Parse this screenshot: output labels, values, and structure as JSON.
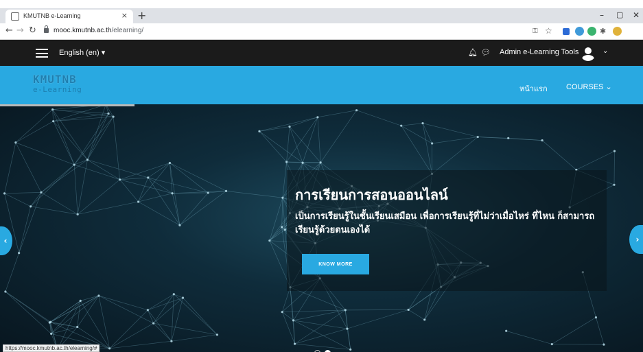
{
  "browser": {
    "tab_title": "KMUTNB e-Learning",
    "tab_close": "×",
    "new_tab": "+",
    "url_host": "mooc.kmutnb.ac.th",
    "url_path": "/elearning/",
    "window_controls": [
      "–",
      "▢",
      "✕"
    ],
    "status_url": "https://mooc.kmutnb.ac.th/elearning/#"
  },
  "site": {
    "language": "English (en)",
    "username": "Admin e-Learning Tools",
    "logo_line1": "KMUTNB",
    "logo_line2": "e-Learning",
    "nav": {
      "home": "หน้าแรก",
      "courses": "COURSES"
    }
  },
  "hero": {
    "title": "การเรียนการสอนออนไลน์",
    "text": "เป็นการเรียนรู้ในชั้นเรียนเสมือน เพื่อการเรียนรู้ที่ไม่ว่าเมื่อไหร่ ที่ไหน ก็สามารถเรียนรู้ด้วยตนเองได้",
    "cta_label": "KNOW MORE",
    "slides": 2,
    "active_slide": 2
  },
  "icons": {
    "menu": "hamburger-icon",
    "notifications": "bell-icon",
    "messages": "chat-icon",
    "user": "avatar-icon"
  },
  "colors": {
    "brand_blue": "#29a9e1",
    "navbar_dark": "#1b1b1b"
  }
}
